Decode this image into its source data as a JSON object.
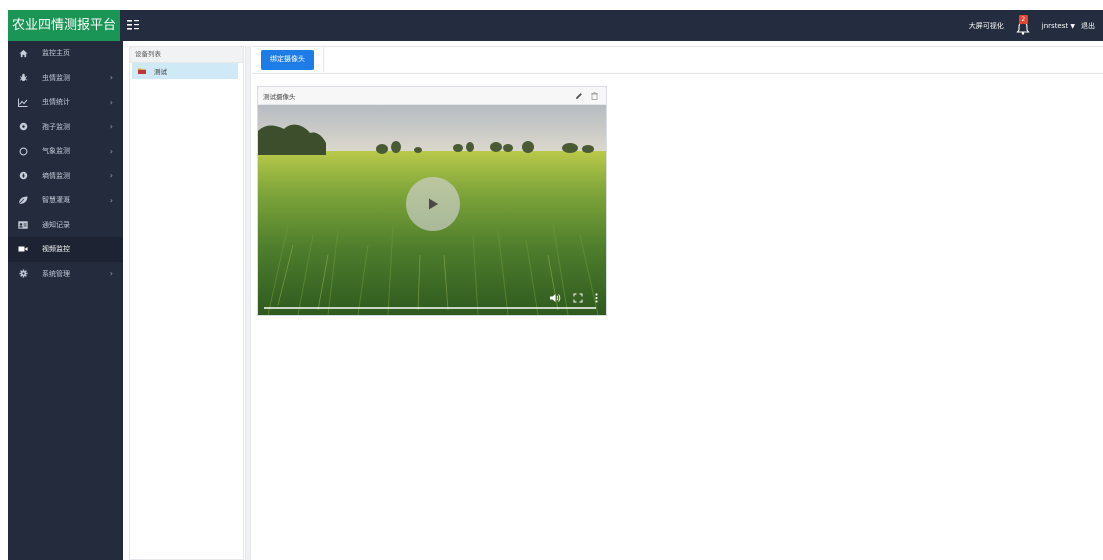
{
  "topbar": {
    "brand": "农业四情测报平台",
    "bigscreen_label": "大屏可视化",
    "notification_count": "2",
    "username": "jnrstest",
    "logout_label": "退出"
  },
  "sidebar": {
    "items": [
      {
        "label": "监控主页",
        "icon": "home-icon",
        "has_arrow": false
      },
      {
        "label": "虫情监测",
        "icon": "bug-icon",
        "has_arrow": true
      },
      {
        "label": "虫情统计",
        "icon": "line-chart-icon",
        "has_arrow": true
      },
      {
        "label": "孢子监测",
        "icon": "spore-icon",
        "has_arrow": true
      },
      {
        "label": "气象监测",
        "icon": "weather-icon",
        "has_arrow": true
      },
      {
        "label": "墒情监测",
        "icon": "soil-icon",
        "has_arrow": true
      },
      {
        "label": "智慧灌溉",
        "icon": "leaf-icon",
        "has_arrow": true
      },
      {
        "label": "通知记录",
        "icon": "id-card-icon",
        "has_arrow": false
      },
      {
        "label": "视频监控",
        "icon": "video-camera-icon",
        "has_arrow": false,
        "active": true
      },
      {
        "label": "系统管理",
        "icon": "gear-icon",
        "has_arrow": true
      }
    ]
  },
  "device_panel": {
    "header": "设备列表",
    "items": [
      {
        "label": "测试",
        "selected": true
      }
    ]
  },
  "main": {
    "bind_button": "绑定摄像头",
    "camera": {
      "title": "测试摄像头"
    }
  },
  "colors": {
    "brand_green": "#1a9556",
    "topbar_bg": "#232d3f",
    "sidebar_bg": "#242b3d",
    "primary_button": "#1e7ce6",
    "selected_row": "#cfe9f6",
    "badge_red": "#e8432f"
  }
}
